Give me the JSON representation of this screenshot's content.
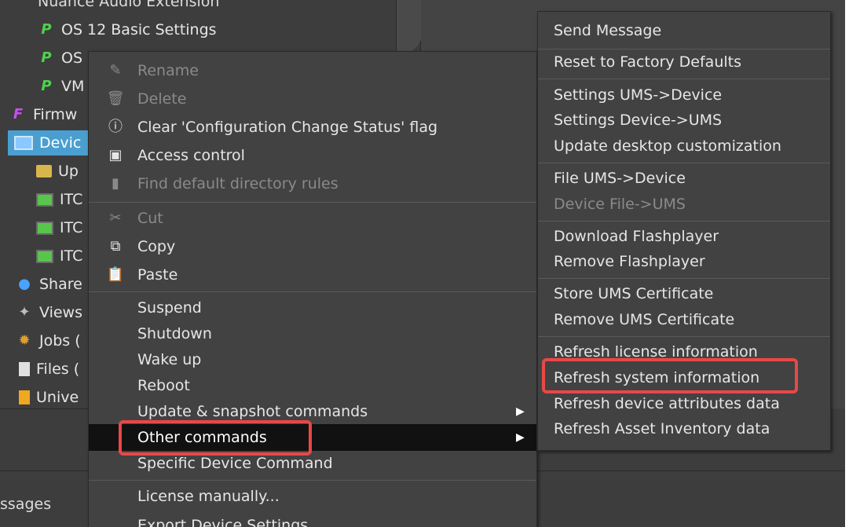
{
  "tree": {
    "cut_top_label": "Nuance Audio Extension",
    "items": [
      {
        "label": "OS 12 Basic Settings"
      },
      {
        "label": "OS"
      },
      {
        "label": "VM"
      },
      {
        "label": "Firmw"
      },
      {
        "label": "Devic"
      },
      {
        "label": "Up"
      },
      {
        "label": "ITC"
      },
      {
        "label": "ITC"
      },
      {
        "label": "ITC"
      },
      {
        "label": "Share"
      },
      {
        "label": "Views"
      },
      {
        "label": "Jobs ("
      },
      {
        "label": "Files ("
      },
      {
        "label": "Unive"
      }
    ]
  },
  "lower": {
    "messages_tab": "ssages"
  },
  "context_menu": {
    "rename": "Rename",
    "delete": "Delete",
    "clear_flag": "Clear 'Configuration Change Status' flag",
    "access_control": "Access control",
    "find_rules": "Find default directory rules",
    "cut": "Cut",
    "copy": "Copy",
    "paste": "Paste",
    "suspend": "Suspend",
    "shutdown": "Shutdown",
    "wake_up": "Wake up",
    "reboot": "Reboot",
    "update_snapshot": "Update & snapshot commands",
    "other_commands": "Other commands",
    "specific_device": "Specific Device Command",
    "license_manually": "License manually...",
    "export_settings": "Export Device Settings"
  },
  "submenu": {
    "send_message": "Send Message",
    "reset_factory": "Reset to Factory Defaults",
    "settings_ums_device": "Settings UMS->Device",
    "settings_device_ums": "Settings Device->UMS",
    "update_desktop": "Update desktop customization",
    "file_ums_device": "File UMS->Device",
    "device_file_ums": "Device File->UMS",
    "download_flash": "Download Flashplayer",
    "remove_flash": "Remove Flashplayer",
    "store_cert": "Store UMS Certificate",
    "remove_cert": "Remove UMS Certificate",
    "refresh_license": "Refresh license information",
    "refresh_system": "Refresh system information",
    "refresh_attributes": "Refresh device attributes data",
    "refresh_asset": "Refresh Asset Inventory data"
  },
  "icons": {
    "profile": "P",
    "firmware": "F",
    "info": "ⓘ",
    "arrow": "▶"
  },
  "colors": {
    "highlight": "#111111",
    "annotation": "#e84848",
    "selected": "#4a9fd0"
  }
}
